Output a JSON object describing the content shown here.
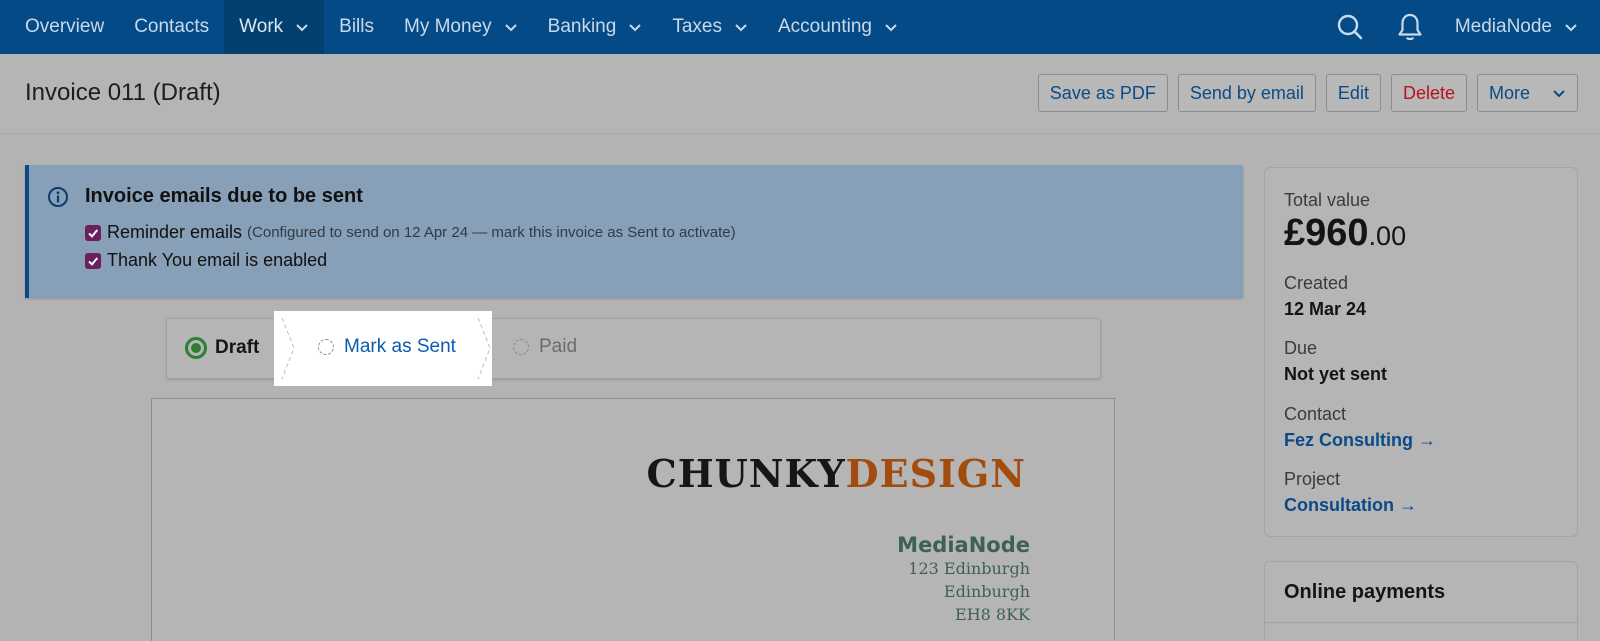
{
  "nav": {
    "items": [
      {
        "label": "Overview",
        "dropdown": false
      },
      {
        "label": "Contacts",
        "dropdown": false
      },
      {
        "label": "Work",
        "dropdown": true,
        "active": true
      },
      {
        "label": "Bills",
        "dropdown": false
      },
      {
        "label": "My Money",
        "dropdown": true
      },
      {
        "label": "Banking",
        "dropdown": true
      },
      {
        "label": "Taxes",
        "dropdown": true
      },
      {
        "label": "Accounting",
        "dropdown": true
      }
    ],
    "account": "MediaNode",
    "icons": [
      "search-icon",
      "bell-icon"
    ]
  },
  "header": {
    "title": "Invoice 011 (Draft)",
    "actions": {
      "save_pdf": "Save as PDF",
      "send_email": "Send by email",
      "edit": "Edit",
      "delete": "Delete",
      "more": "More"
    }
  },
  "alert": {
    "title": "Invoice emails due to be sent",
    "reminder_label": "Reminder emails",
    "reminder_note": "(Configured to send on 12 Apr 24 — mark this invoice as Sent to activate)",
    "thankyou_label": "Thank You email is enabled",
    "reminder_checked": true,
    "thankyou_checked": true
  },
  "stepper": {
    "draft": "Draft",
    "sent": "Mark as Sent",
    "paid": "Paid"
  },
  "invoice": {
    "logo_part1": "CHUNKY",
    "logo_part2": "DESIGN",
    "company_name": "MediaNode",
    "address_line1": "123 Edinburgh",
    "address_line2": "Edinburgh",
    "address_line3": "EH8 8KK"
  },
  "summary": {
    "total_label": "Total value",
    "total_main": "£960",
    "total_pence": ".00",
    "created_label": "Created",
    "created_value": "12 Mar 24",
    "due_label": "Due",
    "due_value": "Not yet sent",
    "contact_label": "Contact",
    "contact_value": "Fez Consulting →",
    "project_label": "Project",
    "project_value": "Consultation →"
  },
  "online_payments": {
    "title": "Online payments"
  },
  "colors": {
    "nav_bg": "#034a87",
    "link": "#0b4a86",
    "delete": "#b7121f",
    "alert_bg": "#879fb7",
    "draft_green": "#2c7e31"
  }
}
